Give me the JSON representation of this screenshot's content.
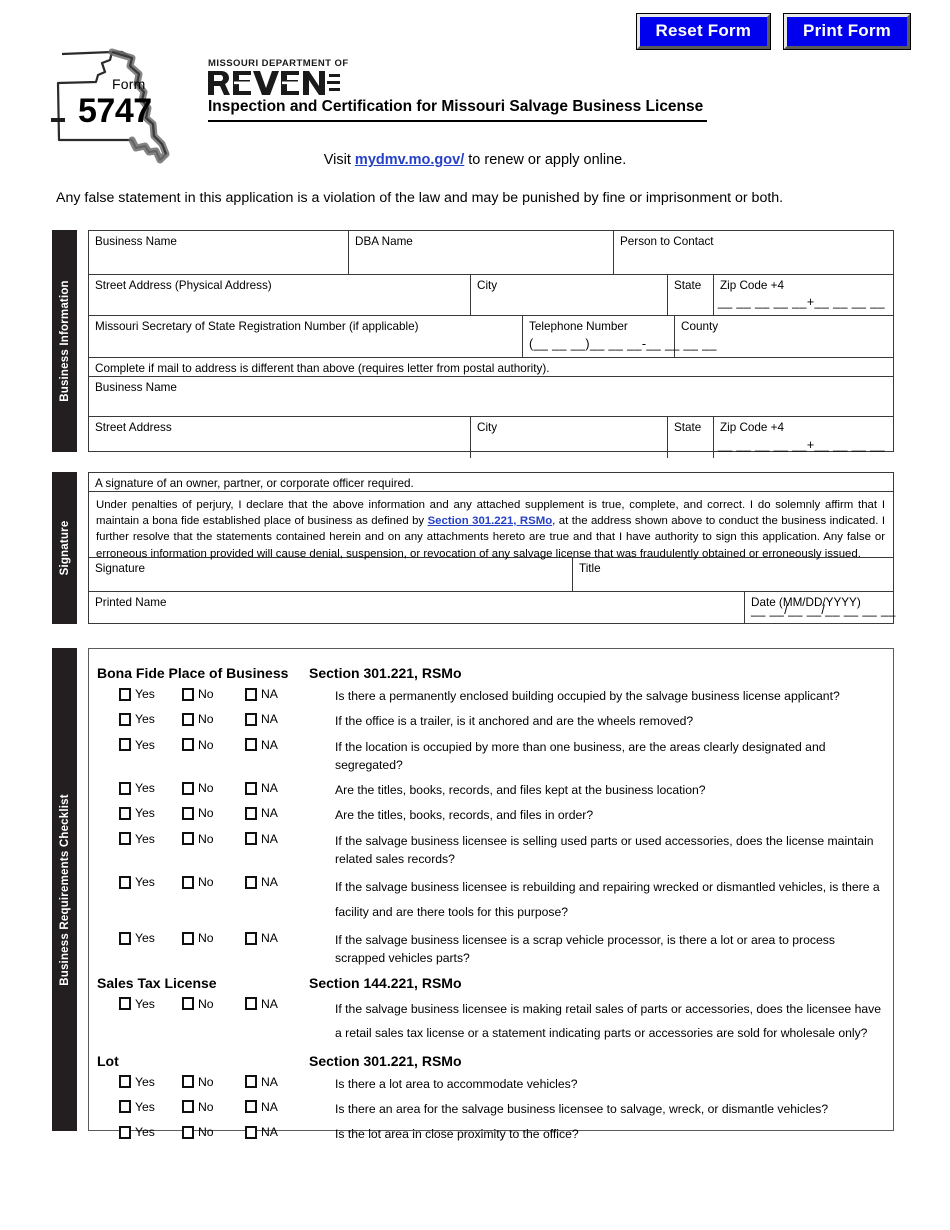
{
  "toolbar": {
    "reset_label": "Reset Form",
    "print_label": "Print Form",
    "button_color": "#0000EE"
  },
  "masthead": {
    "form_word": "Form",
    "form_number": "5747",
    "agency_line1": "MISSOURI DEPARTMENT OF",
    "agency_line2": "REVENUE",
    "doc_title": "Inspection and Certification for Missouri Salvage Business License"
  },
  "visit": {
    "prefix": "Visit ",
    "link": "mydmv.mo.gov/",
    "suffix": " to renew or apply online."
  },
  "warning": "Any false statement in this application is a violation of the law and may be punished by fine or imprisonment or both.",
  "business_information": {
    "tab_label": "Business Information",
    "business_name": "Business Name",
    "dba_name": "DBA Name",
    "person_to_contact": "Person to Contact",
    "street_address_physical": "Street Address (Physical Address)",
    "city": "City",
    "state": "State",
    "zip": "Zip Code +4",
    "zip_mask": "__ __ __ __ __+__ __ __ __",
    "sos_registration": "Missouri Secretary of State Registration Number (if applicable)",
    "telephone": "Telephone Number",
    "telephone_mask": "(__ __ __)__ __ __-__ __ __ __",
    "county": "County",
    "mail_note": "Complete if mail to address is different than above (requires letter from postal authority).",
    "mail_business_name": "Business Name",
    "mail_street_address": "Street Address",
    "mail_city": "City",
    "mail_state": "State",
    "mail_zip": "Zip Code +4",
    "mail_zip_mask": "__ __ __ __ __+__ __ __ __"
  },
  "signature": {
    "tab_label": "Signature",
    "required_note": "A signature of an owner, partner, or corporate officer required.",
    "affirm_part1": "Under penalties of perjury, I declare that the above information and any attached supplement is true, complete, and correct. I do solemnly affirm that I maintain a bona fide established place of business as defined by ",
    "affirm_link": "Section 301.221, RSMo",
    "affirm_part2": ", at the address shown  above to conduct the business indicated. I further resolve that the statements contained herein and on  any attachments hereto are true and that I have authority to sign this application. Any false or erroneous information provided will cause denial, suspension, or revocation of any salvage license that was fraudulently obtained or erroneously issued.",
    "signature_label": "Signature",
    "title_label": "Title",
    "printed_name_label": "Printed Name",
    "date_label": "Date (MM/DD/YYYY)",
    "date_mask": "__ __/__ __/__ __ __ __"
  },
  "checklist": {
    "tab_label": "Business Requirements Checklist",
    "options": [
      "Yes",
      "No",
      "NA"
    ],
    "groups": [
      {
        "name": "Bona Fide Place of Business",
        "section": "Section 301.221, RSMo",
        "questions": [
          "Is there a permanently enclosed building occupied by the salvage business license applicant?",
          "If the office is a trailer, is it anchored and are the wheels removed?",
          "If the location is occupied by more than one business, are the areas clearly designated and segregated?",
          "Are the titles, books, records, and files kept at the business location?",
          "Are the titles, books, records, and files in order?",
          "If the salvage business licensee is selling used parts or used accessories, does the license maintain related sales records?",
          "If the salvage business licensee is rebuilding and repairing wrecked or dismantled vehicles, is there a facility and are there tools for this purpose?",
          "If the salvage business licensee is a scrap vehicle processor, is there a lot or area to process scrapped vehicles parts?"
        ]
      },
      {
        "name": "Sales Tax License",
        "section": "Section 144.221, RSMo",
        "questions": [
          "If the salvage business licensee is making retail sales of parts or accessories, does the licensee have a retail sales tax license or a statement indicating parts or accessories are sold for wholesale only?"
        ]
      },
      {
        "name": "Lot",
        "section": "Section 301.221, RSMo",
        "questions": [
          "Is there a lot area to accommodate vehicles?",
          "Is there an area for the salvage business licensee to salvage, wreck, or dismantle vehicles?",
          "Is the lot area in close proximity to the office?"
        ]
      }
    ]
  }
}
